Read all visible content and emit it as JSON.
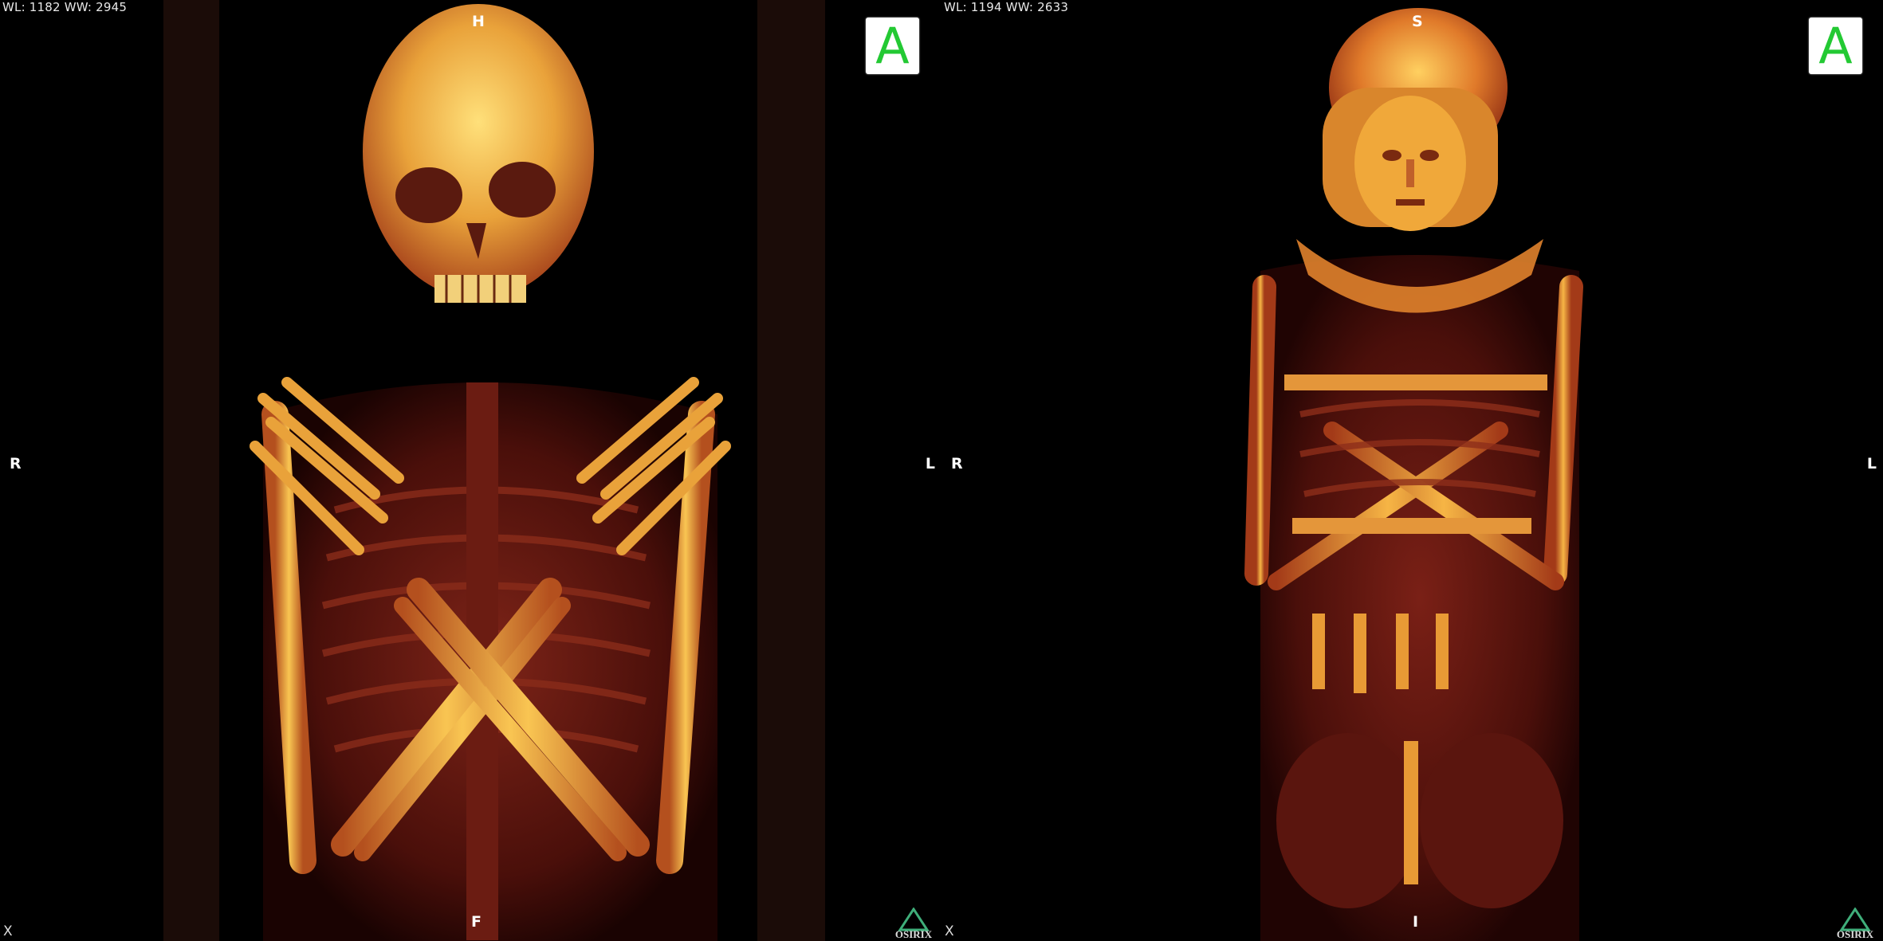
{
  "left_view": {
    "wl_ww": "WL: 1182 WW: 2945",
    "top": "H",
    "bottom": "F",
    "left": "R",
    "right": "L",
    "orientation_button": "A",
    "close": "X",
    "logo": "OsiriX"
  },
  "right_view": {
    "wl_ww": "WL: 1194 WW: 2633",
    "top": "S",
    "bottom": "I",
    "left": "R",
    "right": "L",
    "orientation_button": "A",
    "close": "X",
    "logo": "OsiriX"
  },
  "colors": {
    "background": "#000000",
    "bone_light": "#f4c04a",
    "bone_mid": "#d6782a",
    "tissue": "#7a1c14",
    "button_green": "#23c933"
  },
  "images": {
    "left": "3d-volume-render-mummy-skeleton",
    "right": "3d-volume-render-mummy-mask-and-amulets"
  }
}
